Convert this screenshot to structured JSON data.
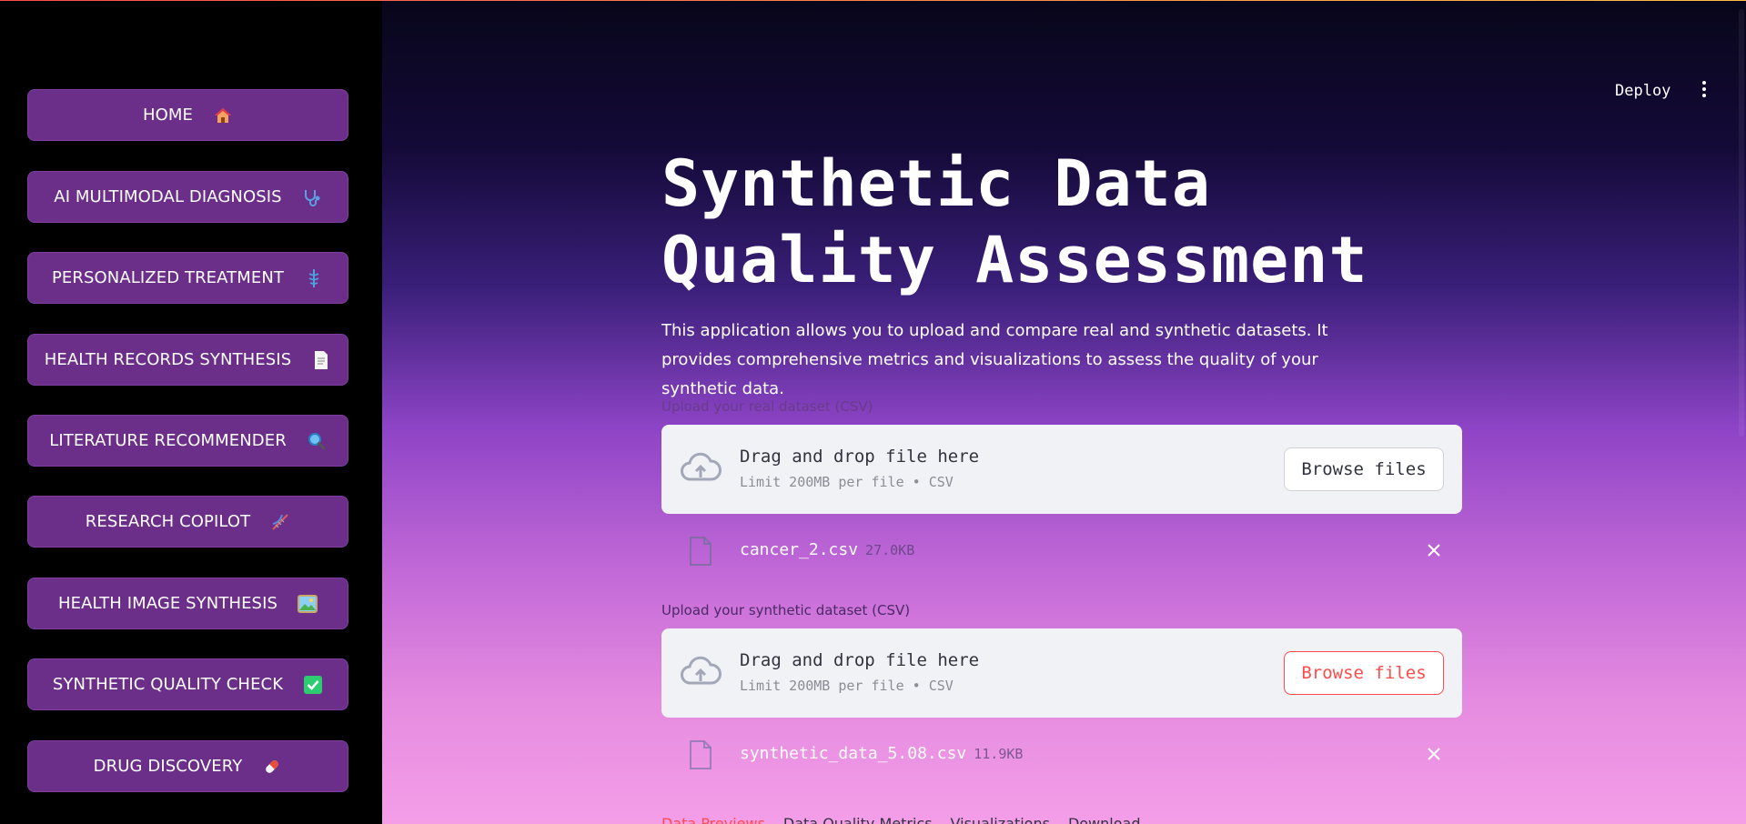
{
  "sidebar": {
    "items": [
      {
        "label": "HOME",
        "icon": "house-icon"
      },
      {
        "label": "AI MULTIMODAL DIAGNOSIS",
        "icon": "stethoscope-icon"
      },
      {
        "label": "PERSONALIZED TREATMENT",
        "icon": "caduceus-icon"
      },
      {
        "label": "HEALTH RECORDS SYNTHESIS",
        "icon": "document-icon"
      },
      {
        "label": "LITERATURE RECOMMENDER",
        "icon": "magnifier-icon"
      },
      {
        "label": "RESEARCH COPILOT",
        "icon": "dna-icon"
      },
      {
        "label": "HEALTH IMAGE SYNTHESIS",
        "icon": "picture-icon"
      },
      {
        "label": "SYNTHETIC QUALITY CHECK",
        "icon": "check-mark-icon"
      },
      {
        "label": "DRUG DISCOVERY",
        "icon": "pill-icon"
      }
    ]
  },
  "header": {
    "deploy_label": "Deploy"
  },
  "main": {
    "title_line1": "Synthetic Data",
    "title_line2": "Quality Assessment",
    "description": "This application allows you to upload and compare real and synthetic datasets. It provides comprehensive metrics and visualizations to assess the quality of your synthetic data."
  },
  "uploads": [
    {
      "label": "Upload your real dataset (CSV)",
      "drop_text": "Drag and drop file here",
      "limit_text": "Limit 200MB per file • CSV",
      "browse_label": "Browse files",
      "file_name": "cancer_2.csv",
      "file_size": "27.0KB"
    },
    {
      "label": "Upload your synthetic dataset (CSV)",
      "drop_text": "Drag and drop file here",
      "limit_text": "Limit 200MB per file • CSV",
      "browse_label": "Browse files",
      "file_name": "synthetic_data_5.08.csv",
      "file_size": "11.9KB"
    }
  ],
  "tabs": [
    "Data Previews",
    "Data Quality Metrics",
    "Visualizations",
    "Download"
  ],
  "colors": {
    "accent": "#ff4b4b",
    "nav_button": "#6b2f8a",
    "sidebar_bg": "#000000"
  }
}
